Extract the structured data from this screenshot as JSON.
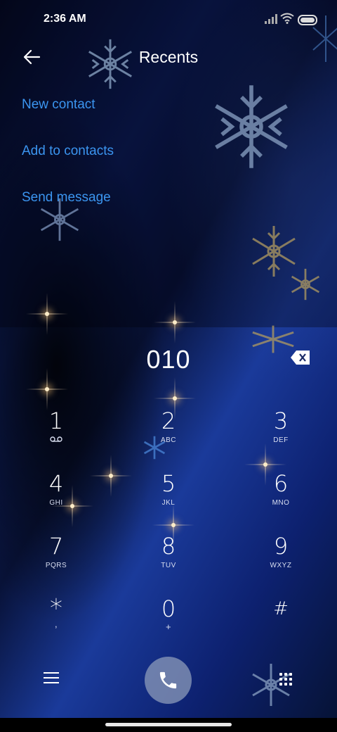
{
  "status_bar": {
    "time": "2:36 AM"
  },
  "header": {
    "title": "Recents"
  },
  "actions": [
    {
      "label": "New contact"
    },
    {
      "label": "Add to contacts"
    },
    {
      "label": "Send message"
    }
  ],
  "dialer": {
    "number": "010",
    "keys": [
      {
        "digit": "1",
        "letters": ""
      },
      {
        "digit": "2",
        "letters": "ABC"
      },
      {
        "digit": "3",
        "letters": "DEF"
      },
      {
        "digit": "4",
        "letters": "GHI"
      },
      {
        "digit": "5",
        "letters": "JKL"
      },
      {
        "digit": "6",
        "letters": "MNO"
      },
      {
        "digit": "7",
        "letters": "PQRS"
      },
      {
        "digit": "8",
        "letters": "TUV"
      },
      {
        "digit": "9",
        "letters": "WXYZ"
      },
      {
        "digit": "*",
        "letters": ","
      },
      {
        "digit": "0",
        "letters": "+"
      },
      {
        "digit": "#",
        "letters": ""
      }
    ]
  },
  "colors": {
    "accent": "#3b95f0",
    "call_button": "#8c9bb9",
    "background": "#0c1c56"
  },
  "icons": [
    "back-arrow-icon",
    "delete-icon",
    "voicemail-icon",
    "menu-icon",
    "phone-icon",
    "dialpad-icon"
  ]
}
